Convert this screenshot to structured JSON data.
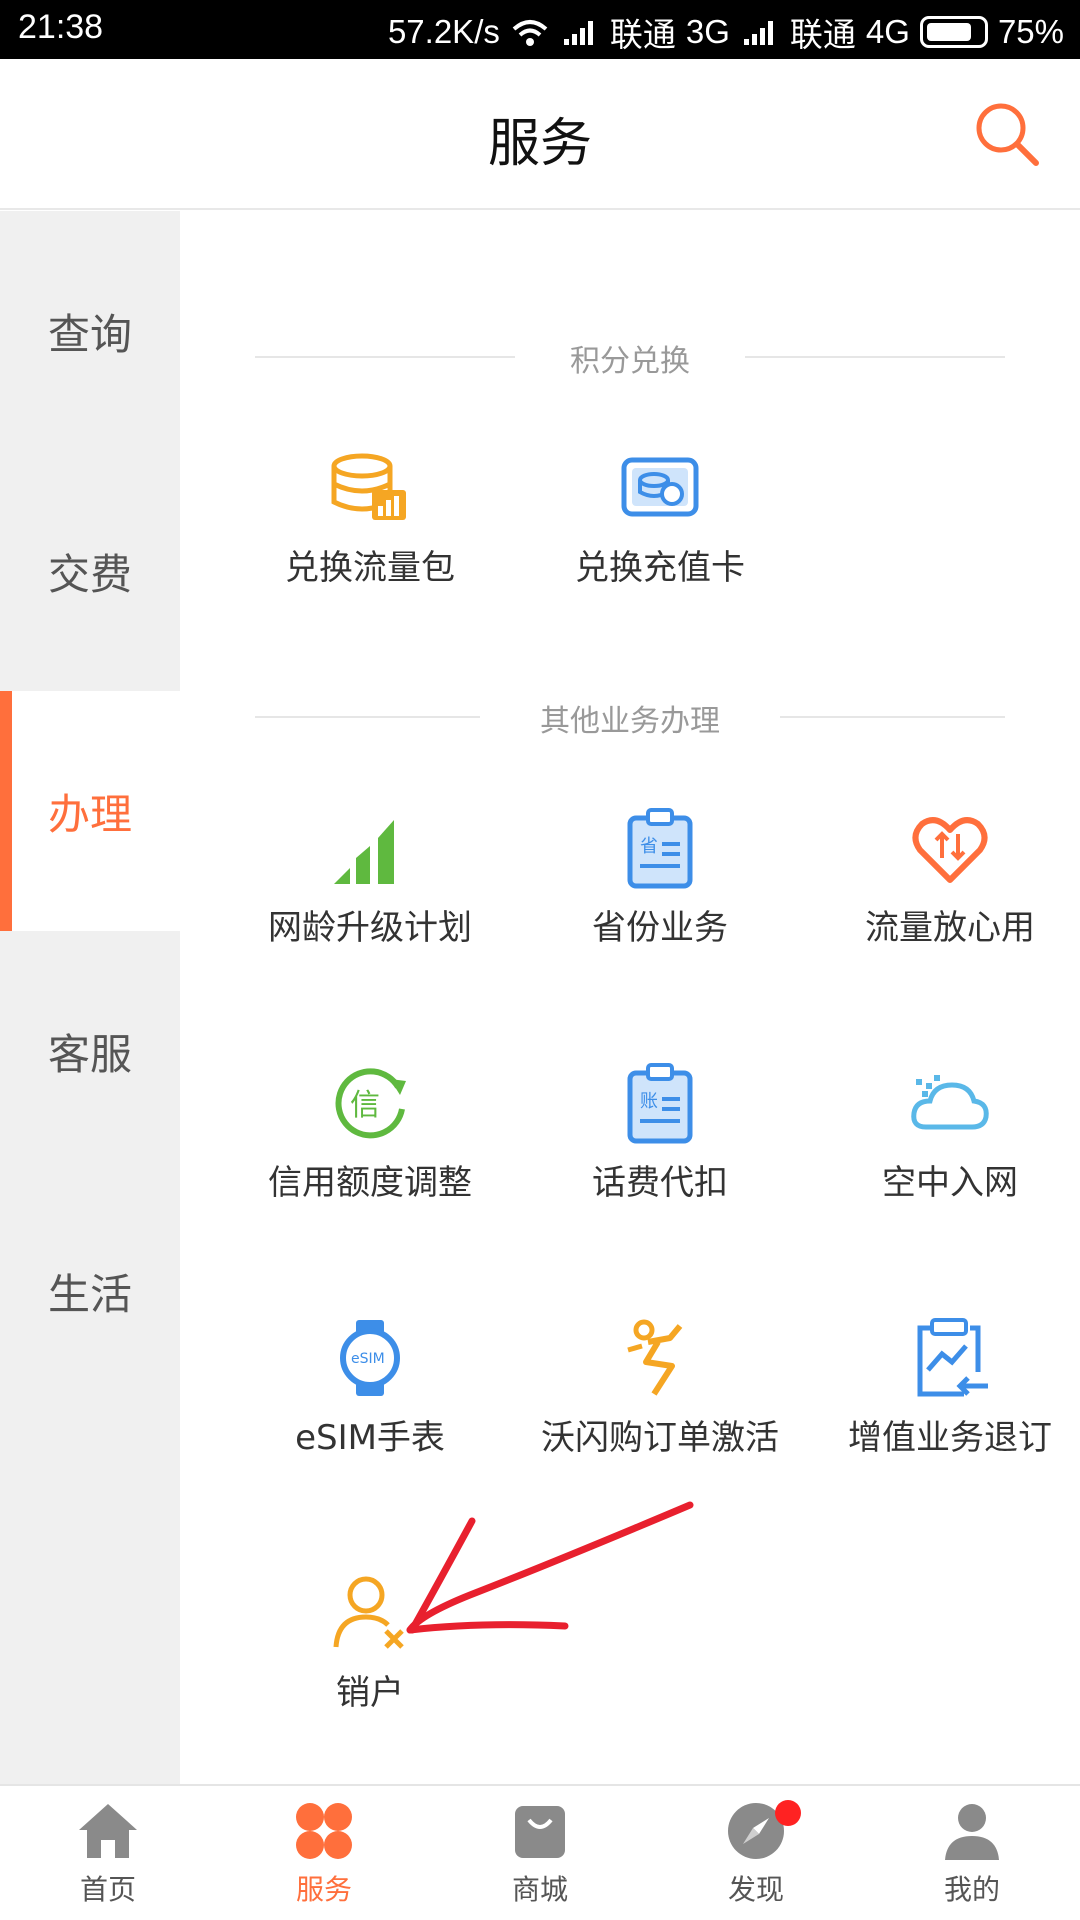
{
  "status_bar": {
    "time": "21:38",
    "speed": "57.2K/s",
    "carrier1": "联通",
    "net1": "3G",
    "carrier2": "联通",
    "net2": "4G",
    "battery": "75%"
  },
  "header": {
    "title": "服务",
    "search_icon": "search-icon",
    "accent": "#ff6f3c"
  },
  "sidebar": {
    "items": [
      {
        "label": "查询"
      },
      {
        "label": "交费"
      },
      {
        "label": "办理",
        "active": true
      },
      {
        "label": "客服"
      },
      {
        "label": "生活"
      }
    ]
  },
  "sections": [
    {
      "title": "积分兑换",
      "items": [
        {
          "label": "兑换流量包",
          "icon": "database-chart-icon"
        },
        {
          "label": "兑换充值卡",
          "icon": "recharge-card-icon"
        }
      ]
    },
    {
      "title": "其他业务办理",
      "items": [
        {
          "label": "网龄升级计划",
          "icon": "signal-bars-icon"
        },
        {
          "label": "省份业务",
          "icon": "province-clipboard-icon"
        },
        {
          "label": "流量放心用",
          "icon": "heart-transfer-icon"
        },
        {
          "label": "信用额度调整",
          "icon": "credit-refresh-icon"
        },
        {
          "label": "话费代扣",
          "icon": "bill-clipboard-icon"
        },
        {
          "label": "空中入网",
          "icon": "cloud-icon"
        },
        {
          "label": "eSIM手表",
          "icon": "smartwatch-icon"
        },
        {
          "label": "沃闪购订单激活",
          "icon": "lightning-runner-icon"
        },
        {
          "label": "增值业务退订",
          "icon": "unsubscribe-clipboard-icon"
        },
        {
          "label": "销户",
          "icon": "user-remove-icon"
        }
      ]
    }
  ],
  "bottom_nav": {
    "items": [
      {
        "label": "首页",
        "icon": "home-icon"
      },
      {
        "label": "服务",
        "icon": "clover-icon",
        "active": true
      },
      {
        "label": "商城",
        "icon": "shopping-bag-icon"
      },
      {
        "label": "发现",
        "icon": "compass-icon",
        "badge": true
      },
      {
        "label": "我的",
        "icon": "profile-icon"
      }
    ]
  }
}
